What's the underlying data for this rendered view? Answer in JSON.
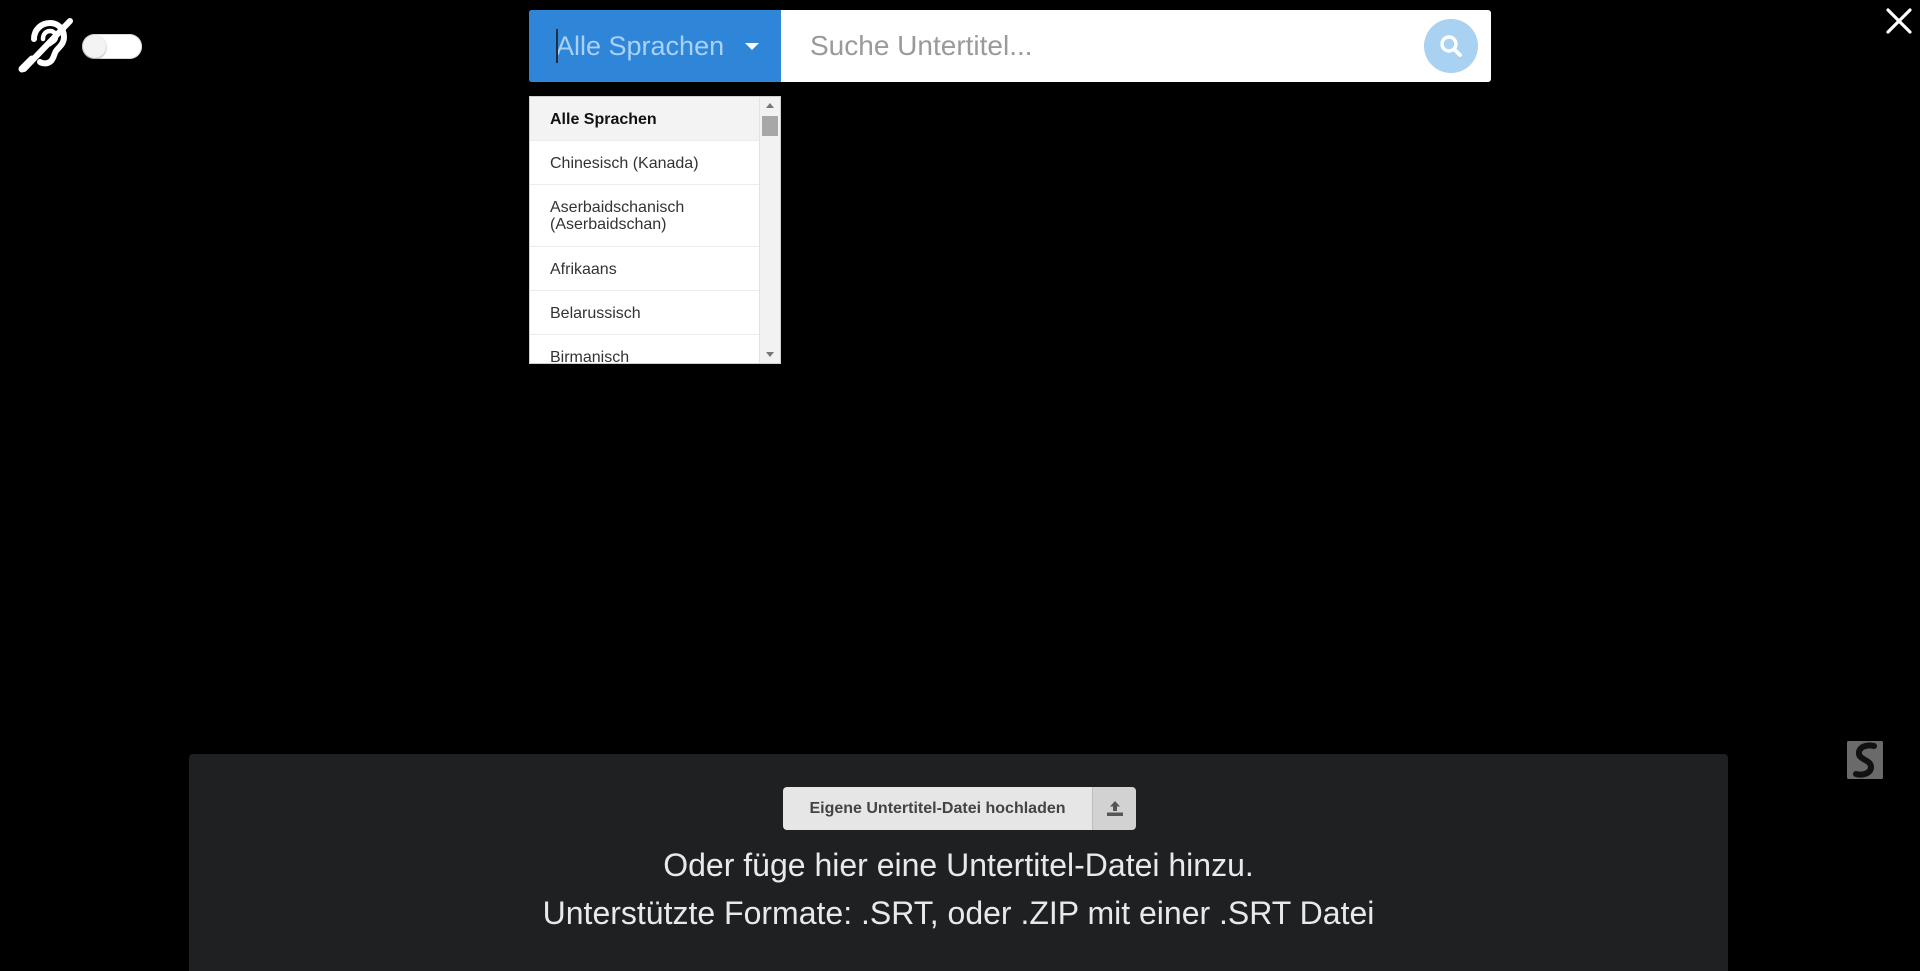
{
  "accessibility": {
    "icon": "hearing-impaired-icon",
    "toggle_state": "off"
  },
  "close": {
    "icon": "close-icon"
  },
  "search": {
    "language_selected": "Alle Sprachen",
    "placeholder": "Suche Untertitel...",
    "value": "",
    "button_icon": "search-icon"
  },
  "languages": {
    "items": [
      {
        "label": "Alle Sprachen",
        "selected": true
      },
      {
        "label": "Chinesisch (Kanada)"
      },
      {
        "label": "Aserbaidschanisch (Aserbaidschan)"
      },
      {
        "label": "Afrikaans"
      },
      {
        "label": "Belarussisch"
      },
      {
        "label": "Birmanisch"
      }
    ]
  },
  "upload": {
    "button_label": "Eigene Untertitel-Datei hochladen",
    "button_icon": "upload-icon",
    "drop_line1": "Oder füge hier eine Untertitel-Datei hinzu.",
    "drop_line2": "Unterstützte Formate: .SRT, oder .ZIP mit einer .SRT Datei"
  },
  "colors": {
    "accent": "#2f85d8",
    "search_button": "#a8d1f2",
    "panel": "#1f2022",
    "background": "#000000"
  }
}
